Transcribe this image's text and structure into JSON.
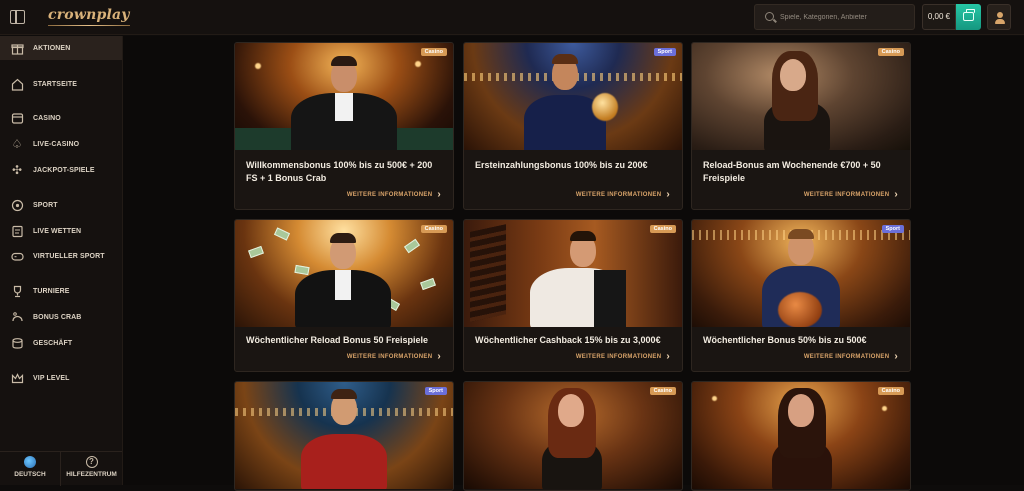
{
  "app": {
    "logo_text": "crownplay",
    "accent_color": "#27c7a6",
    "brand_color": "#d9b27a"
  },
  "header": {
    "search_placeholder": "Spiele, Kategorien, Anbieter",
    "balance": "0,00 €",
    "icons": [
      "sidebar-toggle-icon",
      "search-icon",
      "wallet-icon",
      "user-icon"
    ]
  },
  "sidebar": {
    "items": [
      {
        "label": "AKTIONEN",
        "icon": "gift-icon",
        "active": true
      },
      {
        "label": "STARTSEITE",
        "icon": "home-icon"
      },
      {
        "label": "CASINO",
        "icon": "slot-machine-icon"
      },
      {
        "label": "LIVE-CASINO",
        "icon": "spade-icon"
      },
      {
        "label": "JACKPOT-SPIELE",
        "icon": "clover-icon"
      },
      {
        "label": "SPORT",
        "icon": "soccer-ball-icon"
      },
      {
        "label": "LIVE WETTEN",
        "icon": "live-bet-icon"
      },
      {
        "label": "VIRTUELLER SPORT",
        "icon": "gamepad-icon"
      },
      {
        "label": "TURNIERE",
        "icon": "trophy-icon"
      },
      {
        "label": "BONUS CRAB",
        "icon": "crab-icon"
      },
      {
        "label": "GESCHÄFT",
        "icon": "coins-icon"
      },
      {
        "label": "VIP LEVEL",
        "icon": "crown-icon"
      }
    ],
    "footer": {
      "language_label": "DEUTSCH",
      "help_label": "HILFEZENTRUM"
    }
  },
  "promotions": {
    "more_label": "WEITERE INFORMATIONEN",
    "cards": [
      {
        "badge": "Casino",
        "title": "Willkommensbonus 100% bis zu 500€ + 200 FS + 1 Bonus Crab"
      },
      {
        "badge": "Sport",
        "title": "Ersteinzahlungsbonus 100% bis zu 200€"
      },
      {
        "badge": "Casino",
        "title": "Reload-Bonus am Wochenende €700 + 50 Freispiele"
      },
      {
        "badge": "Casino",
        "title": "Wöchentlicher Reload Bonus 50 Freispiele"
      },
      {
        "badge": "Casino",
        "title": "Wöchentlicher Cashback 15% bis zu 3,000€"
      },
      {
        "badge": "Sport",
        "title": "Wöchentlicher Bonus 50% bis zu 500€"
      },
      {
        "badge": "Sport",
        "title": ""
      },
      {
        "badge": "Casino",
        "title": ""
      },
      {
        "badge": "Casino",
        "title": ""
      }
    ]
  }
}
